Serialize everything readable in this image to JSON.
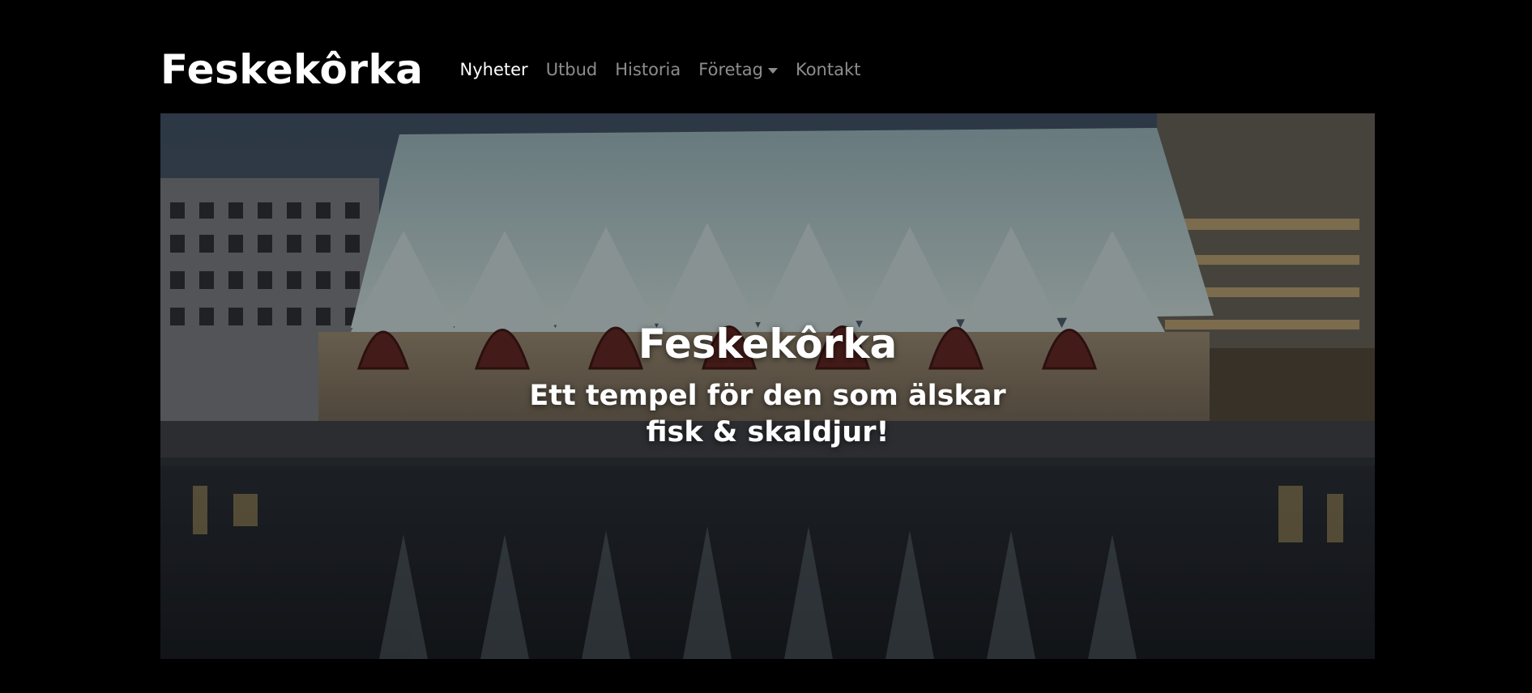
{
  "navbar": {
    "brand": "Feskekôrka",
    "items": [
      {
        "label": "Nyheter",
        "active": true
      },
      {
        "label": "Utbud",
        "active": false
      },
      {
        "label": "Historia",
        "active": false
      },
      {
        "label": "Företag",
        "active": false,
        "dropdown": true
      },
      {
        "label": "Kontakt",
        "active": false
      }
    ]
  },
  "hero": {
    "title": "Feskekôrka",
    "subtitle": "Ett tempel för den som älskar fisk & skaldjur!"
  },
  "colors": {
    "background": "#000000",
    "text": "#ffffff",
    "nav_inactive": "rgba(255,255,255,0.55)"
  }
}
